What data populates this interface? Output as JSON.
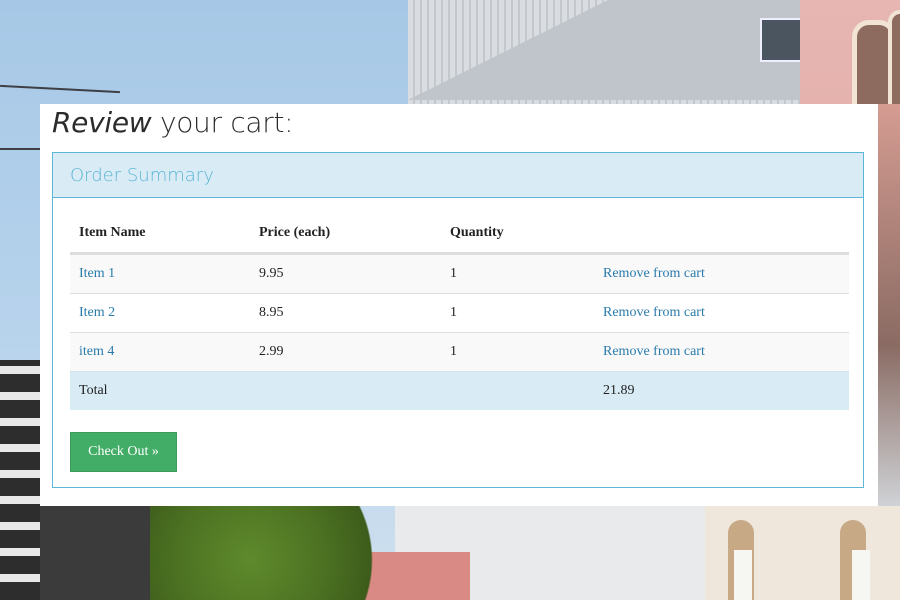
{
  "page": {
    "title_emphasis": "Review",
    "title_rest": " your cart:"
  },
  "summary": {
    "title": "Order Summary",
    "columns": [
      "Item Name",
      "Price (each)",
      "Quantity",
      ""
    ],
    "items": [
      {
        "name": "Item 1",
        "price": "9.95",
        "quantity": "1",
        "action": "Remove from cart"
      },
      {
        "name": "Item 2",
        "price": "8.95",
        "quantity": "1",
        "action": "Remove from cart"
      },
      {
        "name": "item 4",
        "price": "2.99",
        "quantity": "1",
        "action": "Remove from cart"
      }
    ],
    "total_label": "Total",
    "total_value": "21.89"
  },
  "checkout": {
    "label": "Check Out »"
  },
  "colors": {
    "panel_border": "#5cb6d8",
    "panel_header_bg": "#d9ecf6",
    "link": "#2a7bab",
    "checkout_bg": "#42ad66"
  }
}
